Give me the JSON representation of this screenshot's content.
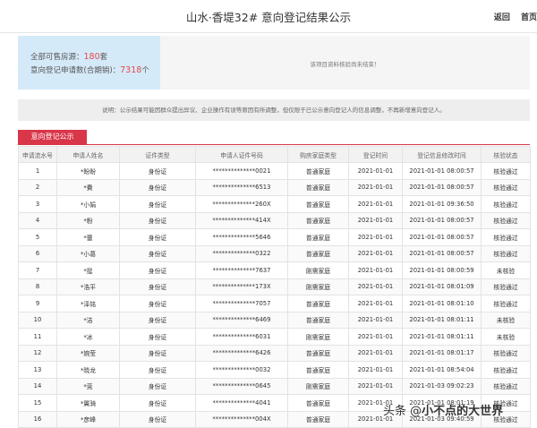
{
  "header": {
    "title": "山水·香堤32# 意向登记结果公示",
    "nav": [
      "返回",
      "首页"
    ]
  },
  "summary": {
    "available_label": "全部可售房源：",
    "available_count": "180",
    "available_unit": "套",
    "applications_label": "意向登记申请数(合期销)：",
    "applications_count": "7318",
    "applications_unit": "个",
    "verify_message": "该项目资料核验尚未结束！"
  },
  "notice": "说明：公示结果可能因群众提出异议、企业操作有误等原因有所调整，但仅限于已公示意向登记人的信息调整，不再新增意向登记人。",
  "tab_label": "意向登记公示",
  "table": {
    "columns": [
      "申请流水号",
      "申请人姓名",
      "证件类型",
      "申请人证件号码",
      "购房家庭类型",
      "登记时间",
      "登记信息修改时间",
      "核验状态"
    ],
    "rows": [
      [
        "1",
        "*盼盼",
        "身份证",
        "**************0021",
        "普通家庭",
        "2021-01-01",
        "2021-01-01 08:00:57",
        "核验通过"
      ],
      [
        "2",
        "*費",
        "身份证",
        "**************6513",
        "普通家庭",
        "2021-01-01",
        "2021-01-01 08:00:57",
        "核验通过"
      ],
      [
        "3",
        "*小娟",
        "身份证",
        "**************260X",
        "普通家庭",
        "2021-01-01",
        "2021-01-01 09:36:50",
        "核验通过"
      ],
      [
        "4",
        "*粉",
        "身份证",
        "**************414X",
        "普通家庭",
        "2021-01-01",
        "2021-01-01 08:00:57",
        "核验通过"
      ],
      [
        "5",
        "*蕾",
        "身份证",
        "**************5646",
        "普通家庭",
        "2021-01-01",
        "2021-01-01 08:00:57",
        "核验通过"
      ],
      [
        "6",
        "*小葛",
        "身份证",
        "**************0322",
        "普通家庭",
        "2021-01-01",
        "2021-01-01 08:00:57",
        "核验通过"
      ],
      [
        "7",
        "*挺",
        "身份证",
        "**************7637",
        "刚需家庭",
        "2021-01-01",
        "2021-01-01 08:00:59",
        "未核验"
      ],
      [
        "8",
        "*浩平",
        "身份证",
        "**************173X",
        "刚需家庭",
        "2021-01-01",
        "2021-01-01 08:01:09",
        "核验通过"
      ],
      [
        "9",
        "*泽铭",
        "身份证",
        "**************7057",
        "普通家庭",
        "2021-01-01",
        "2021-01-01 08:01:10",
        "核验通过"
      ],
      [
        "10",
        "*洁",
        "身份证",
        "**************6469",
        "普通家庭",
        "2021-01-01",
        "2021-01-01 08:01:11",
        "未核验"
      ],
      [
        "11",
        "*冰",
        "身份证",
        "**************6031",
        "刚需家庭",
        "2021-01-01",
        "2021-01-01 08:01:11",
        "未核验"
      ],
      [
        "12",
        "*婉莹",
        "身份证",
        "**************6426",
        "普通家庭",
        "2021-01-01",
        "2021-01-01 08:01:17",
        "核验通过"
      ],
      [
        "13",
        "*晓龙",
        "身份证",
        "**************0032",
        "普通家庭",
        "2021-01-01",
        "2021-01-01 08:54:04",
        "核验通过"
      ],
      [
        "14",
        "*莞",
        "身份证",
        "**************0645",
        "刚需家庭",
        "2021-01-01",
        "2021-01-03 09:02:23",
        "核验通过"
      ],
      [
        "15",
        "*翼骑",
        "身份证",
        "**************4041",
        "普通家庭",
        "2021-01-01",
        "2021-01-01 08:01:19",
        "核验通过"
      ],
      [
        "16",
        "*彦峰",
        "身份证",
        "**************004X",
        "普通家庭",
        "2021-01-01",
        "2021-01-03 09:40:59",
        "核验通过"
      ]
    ]
  },
  "watermark": {
    "prefix": "头条 @",
    "name": "小不点的大世界"
  }
}
